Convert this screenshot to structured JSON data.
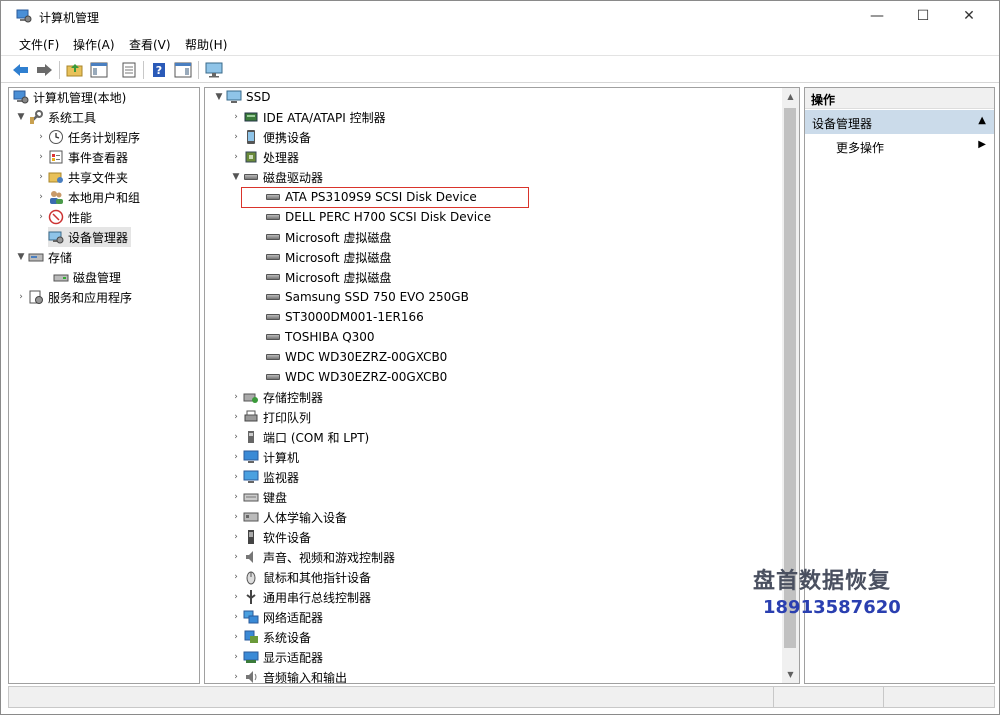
{
  "window": {
    "title": "计算机管理",
    "controls": {
      "minimize": "—",
      "maximize": "☐",
      "close": "✕"
    }
  },
  "menu": [
    "文件(F)",
    "操作(A)",
    "查看(V)",
    "帮助(H)"
  ],
  "toolbar": {
    "buttons": [
      "back-icon",
      "forward-icon",
      "up-folder-icon",
      "show-hide-tree-icon",
      "properties-icon",
      "help-icon",
      "show-hide-action-icon",
      "monitor-icon"
    ]
  },
  "left_tree": {
    "root": "计算机管理(本地)",
    "system_tools": "系统工具",
    "task_scheduler": "任务计划程序",
    "event_viewer": "事件查看器",
    "shared_folders": "共享文件夹",
    "local_users": "本地用户和组",
    "performance": "性能",
    "device_manager": "设备管理器",
    "storage": "存储",
    "disk_management": "磁盘管理",
    "services_apps": "服务和应用程序"
  },
  "device_tree": {
    "root": "SSD",
    "categories_before": [
      "IDE ATA/ATAPI 控制器",
      "便携设备",
      "处理器"
    ],
    "disk_drives_label": "磁盘驱动器",
    "disks": [
      "ATA PS3109S9 SCSI Disk Device",
      "DELL PERC H700 SCSI Disk Device",
      "Microsoft 虚拟磁盘",
      "Microsoft 虚拟磁盘",
      "Microsoft 虚拟磁盘",
      "Samsung SSD 750 EVO 250GB",
      "ST3000DM001-1ER166",
      "TOSHIBA Q300",
      "WDC WD30EZRZ-00GXCB0",
      "WDC WD30EZRZ-00GXCB0"
    ],
    "categories_after": [
      "存储控制器",
      "打印队列",
      "端口 (COM 和 LPT)",
      "计算机",
      "监视器",
      "键盘",
      "人体学输入设备",
      "软件设备",
      "声音、视频和游戏控制器",
      "鼠标和其他指针设备",
      "通用串行总线控制器",
      "网络适配器",
      "系统设备",
      "显示适配器",
      "音频输入和输出"
    ]
  },
  "actions": {
    "header": "操作",
    "section": "设备管理器",
    "more": "更多操作"
  },
  "watermark": {
    "line1": "盘首数据恢复",
    "line2": "18913587620"
  }
}
